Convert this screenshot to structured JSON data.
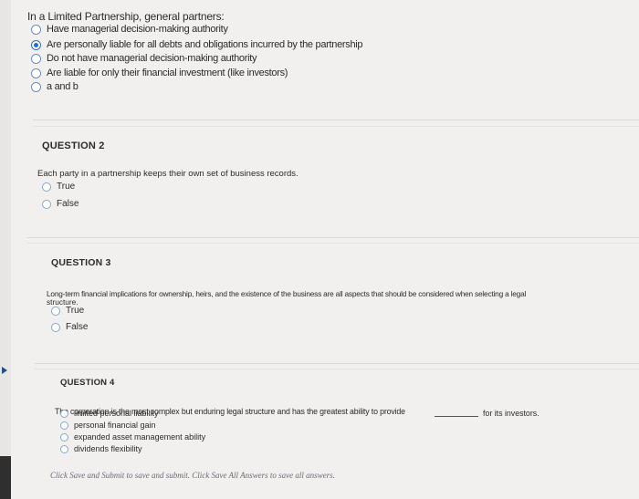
{
  "question1": {
    "prompt": "In a Limited Partnership, general partners:",
    "options": [
      {
        "label": "Have managerial decision-making authority",
        "selected": false
      },
      {
        "label": "Are personally liable for all debts and obligations incurred by the partnership",
        "selected": true
      },
      {
        "label": "Do not have managerial decision-making authority",
        "selected": false
      },
      {
        "label": "Are liable for only their financial investment (like investors)",
        "selected": false
      },
      {
        "label": "a and b",
        "selected": false
      }
    ]
  },
  "question2": {
    "title": "QUESTION 2",
    "prompt": "Each party in a partnership keeps their own set of business records.",
    "options": [
      {
        "label": "True",
        "selected": false
      },
      {
        "label": "False",
        "selected": false
      }
    ]
  },
  "question3": {
    "title": "QUESTION 3",
    "prompt_line1": "Long-term financial implications for ownership, heirs, and the existence of the business are all aspects that should be considered when selecting a legal",
    "prompt_line2": "structure.",
    "options": [
      {
        "label": "True",
        "selected": false
      },
      {
        "label": "False",
        "selected": false
      }
    ]
  },
  "question4": {
    "title": "QUESTION 4",
    "prompt_before": "The corporation is the most complex but enduring legal structure and has the greatest ability to provide",
    "prompt_after": "for its investors.",
    "options": [
      {
        "label": "limited personal liability",
        "selected": false
      },
      {
        "label": "personal financial gain",
        "selected": false
      },
      {
        "label": "expanded asset management ability",
        "selected": false
      },
      {
        "label": "dividends flexibility",
        "selected": false
      }
    ]
  },
  "footer": {
    "text": "Click Save and Submit to save and submit. Click Save All Answers to save all answers."
  },
  "colors": {
    "background": "#f1f0ee",
    "radio_selected": "#1d6fd6",
    "radio_border": "#6a8fb8"
  }
}
